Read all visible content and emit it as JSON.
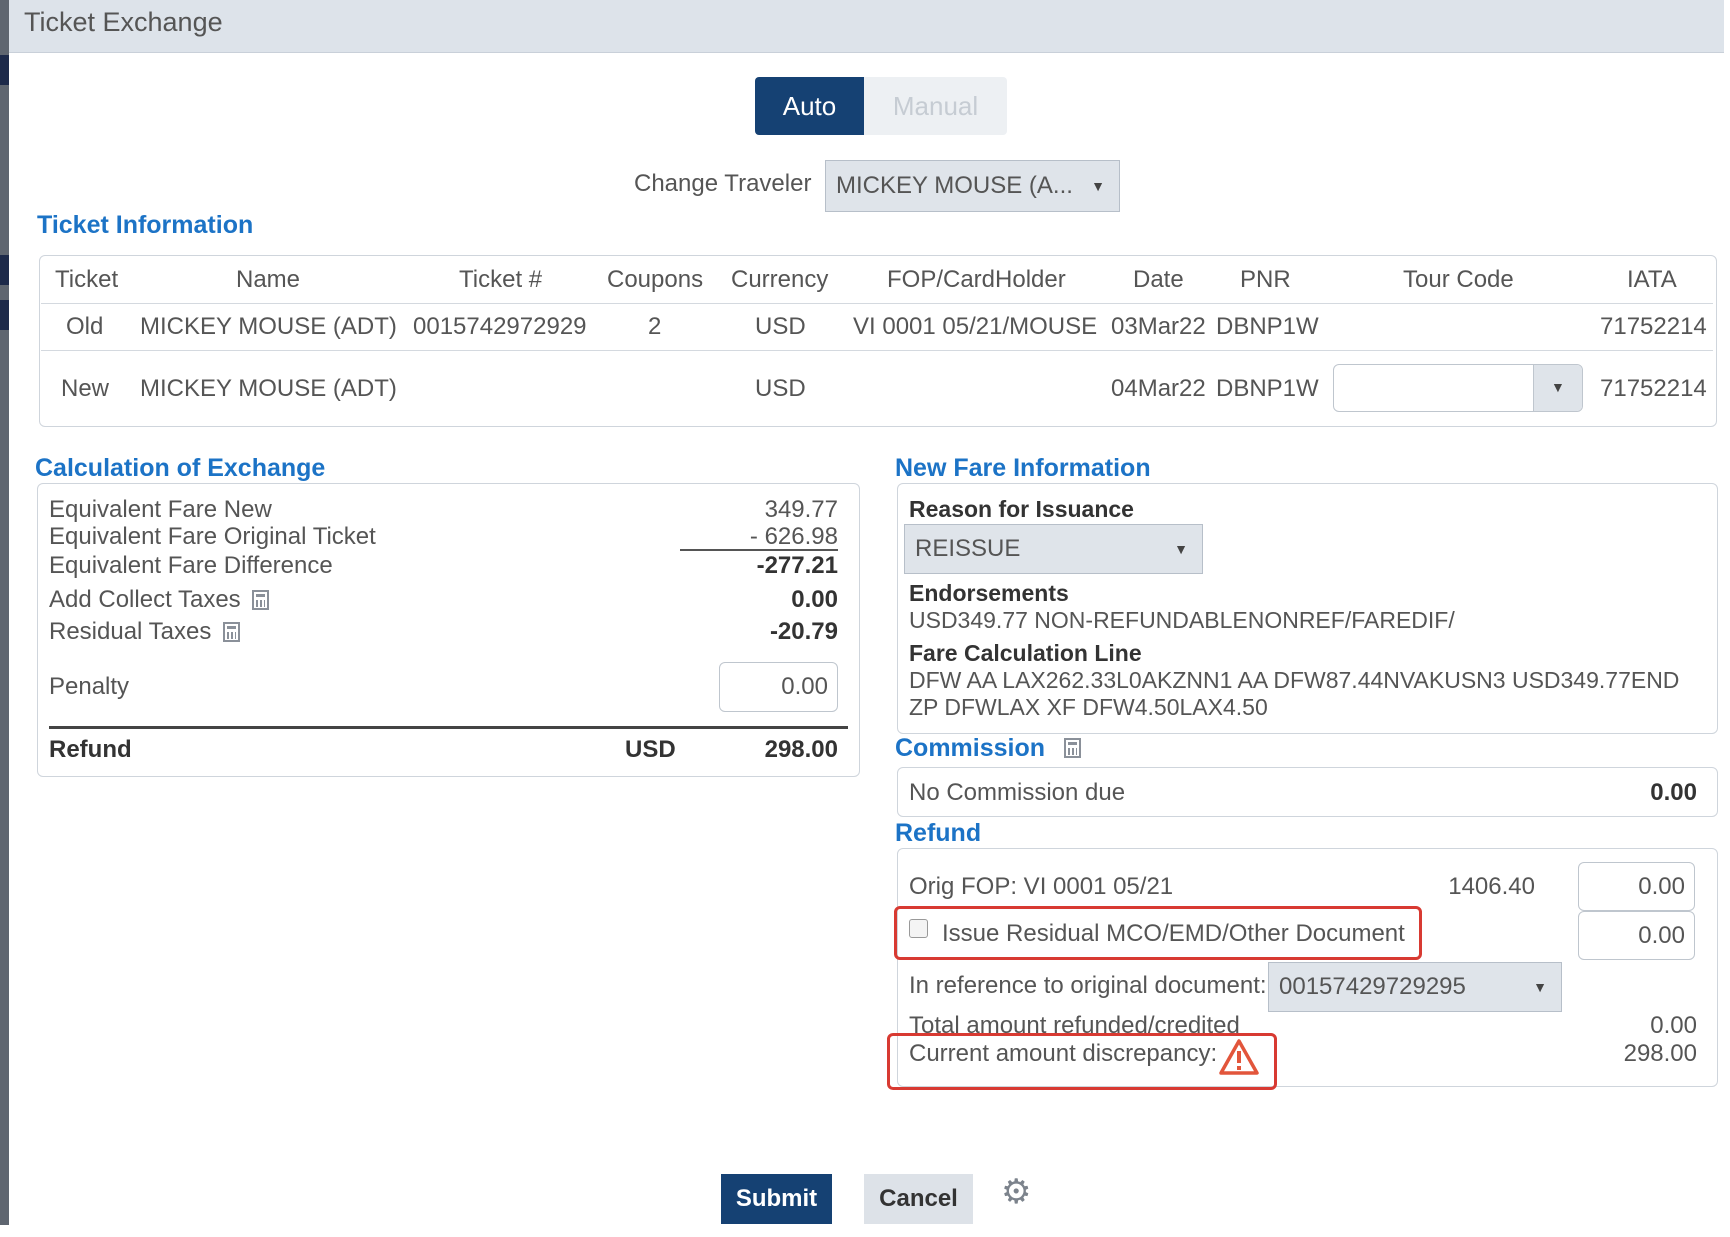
{
  "window": {
    "title": "Ticket Exchange"
  },
  "mode_toggle": {
    "auto_label": "Auto",
    "manual_label": "Manual",
    "selected": "Auto"
  },
  "traveler": {
    "label": "Change Traveler",
    "selected": "MICKEY MOUSE (A..."
  },
  "ticket_information": {
    "title": "Ticket Information",
    "columns": [
      "Ticket",
      "Name",
      "Ticket #",
      "Coupons",
      "Currency",
      "FOP/CardHolder",
      "Date",
      "PNR",
      "Tour Code",
      "IATA"
    ],
    "old": {
      "ticket": "Old",
      "name": "MICKEY MOUSE (ADT)",
      "ticket_no": "0015742972929",
      "coupons": "2",
      "currency": "USD",
      "fop": "VI 0001 05/21/MOUSE",
      "date": "03Mar22",
      "pnr": "DBNP1W",
      "iata": "71752214"
    },
    "new": {
      "ticket": "New",
      "name": "MICKEY MOUSE (ADT)",
      "currency": "USD",
      "date": "04Mar22",
      "pnr": "DBNP1W",
      "tour_code": "",
      "iata": "71752214"
    }
  },
  "calculation": {
    "title": "Calculation of Exchange",
    "fare_new_label": "Equivalent Fare New",
    "fare_new_value": "349.77",
    "fare_orig_label": "Equivalent Fare Original Ticket",
    "fare_orig_value": "- 626.98",
    "fare_diff_label": "Equivalent Fare Difference",
    "fare_diff_value": "-277.21",
    "add_collect_label": "Add Collect Taxes",
    "add_collect_value": "0.00",
    "residual_label": "Residual Taxes",
    "residual_value": "-20.79",
    "penalty_label": "Penalty",
    "penalty_value": "0.00",
    "refund_label": "Refund",
    "refund_currency": "USD",
    "refund_value": "298.00"
  },
  "new_fare": {
    "title": "New Fare Information",
    "reason_label": "Reason for Issuance",
    "reason_value": "REISSUE",
    "endorsements_label": "Endorsements",
    "endorsements_value": "USD349.77 NON-REFUNDABLENONREF/FAREDIF/",
    "fare_calc_label": "Fare Calculation Line",
    "fare_calc_line1": "DFW AA LAX262.33L0AKZNN1 AA DFW87.44NVAKUSN3 USD349.77END",
    "fare_calc_line2": "ZP DFWLAX XF DFW4.50LAX4.50"
  },
  "commission": {
    "title": "Commission",
    "label": "No Commission due",
    "value": "0.00"
  },
  "refund": {
    "title": "Refund",
    "orig_fop_label": "Orig FOP: VI 0001 05/21",
    "orig_fop_amount": "1406.40",
    "orig_fop_input": "0.00",
    "issue_residual_label": "Issue Residual MCO/EMD/Other Document",
    "issue_residual_input": "0.00",
    "reference_label": "In reference to original document:",
    "reference_value": "00157429729295",
    "total_label": "Total amount refunded/credited",
    "total_value": "0.00",
    "discrepancy_label": "Current amount discrepancy:",
    "discrepancy_value": "298.00"
  },
  "actions": {
    "submit": "Submit",
    "cancel": "Cancel"
  },
  "colors": {
    "accent": "#154173",
    "link": "#1c73c6",
    "highlight": "#d83a32"
  },
  "icons": [
    "calculator-icon",
    "warning-icon",
    "gear-icon",
    "chevron-down-icon"
  ]
}
